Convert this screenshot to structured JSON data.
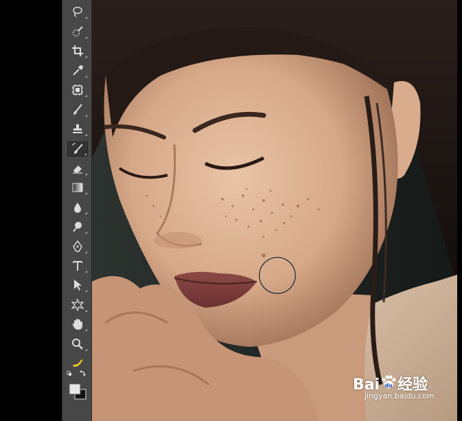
{
  "toolbar": {
    "tools": [
      {
        "name": "lasso-tool",
        "icon": "lasso-icon"
      },
      {
        "name": "quick-selection-tool",
        "icon": "quick-selection-icon"
      },
      {
        "name": "crop-tool",
        "icon": "crop-icon"
      },
      {
        "name": "eyedropper-tool",
        "icon": "eyedropper-icon"
      },
      {
        "name": "frame-tool",
        "icon": "frame-icon"
      },
      {
        "name": "brush-tool",
        "icon": "brush-icon"
      },
      {
        "name": "clone-stamp-tool",
        "icon": "stamp-icon"
      },
      {
        "name": "history-brush-tool",
        "icon": "history-brush-icon",
        "active": true
      },
      {
        "name": "eraser-tool",
        "icon": "eraser-icon"
      },
      {
        "name": "gradient-tool",
        "icon": "gradient-icon"
      },
      {
        "name": "blur-tool",
        "icon": "drop-icon"
      },
      {
        "name": "dodge-tool",
        "icon": "dodge-icon"
      },
      {
        "name": "pen-tool",
        "icon": "pen-icon"
      },
      {
        "name": "type-tool",
        "icon": "type-icon",
        "label": "T"
      },
      {
        "name": "path-selection-tool",
        "icon": "arrow-icon"
      },
      {
        "name": "custom-shape-tool",
        "icon": "shape-icon"
      },
      {
        "name": "hand-tool",
        "icon": "hand-icon"
      },
      {
        "name": "zoom-tool",
        "icon": "magnifier-icon"
      },
      {
        "name": "banana-tool",
        "icon": "banana-icon"
      }
    ],
    "foreground_color": "#e8e8e8",
    "background_color": "#111111"
  },
  "watermark": {
    "brand": "Bai",
    "brand_cn": "经验",
    "site": "jingyan.baidu.com"
  },
  "canvas": {
    "brush_cursor": "circle-brush-cursor"
  }
}
